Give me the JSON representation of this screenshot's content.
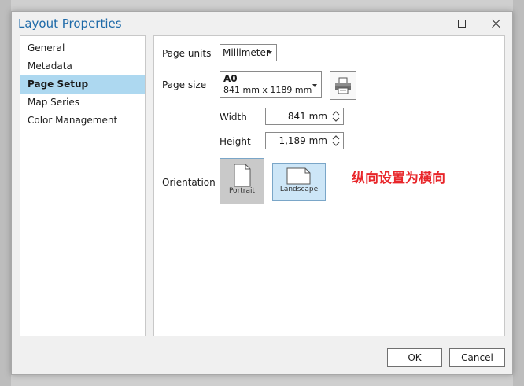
{
  "window": {
    "title": "Layout Properties"
  },
  "sidebar": {
    "items": [
      {
        "label": "General"
      },
      {
        "label": "Metadata"
      },
      {
        "label": "Page Setup"
      },
      {
        "label": "Map Series"
      },
      {
        "label": "Color Management"
      }
    ],
    "active_index": 2
  },
  "page_setup": {
    "units_label": "Page units",
    "units_value": "Millimeter",
    "size_label": "Page size",
    "size_name": "A0",
    "size_dims": "841 mm x 1189 mm",
    "width_label": "Width",
    "width_value": "841 mm",
    "height_label": "Height",
    "height_value": "1,189 mm",
    "orientation_label": "Orientation",
    "portrait_label": "Portrait",
    "landscape_label": "Landscape",
    "annotation": "纵向设置为横向"
  },
  "footer": {
    "ok_label": "OK",
    "cancel_label": "Cancel"
  },
  "colors": {
    "title": "#1e6aa8",
    "active_nav": "#add8f0",
    "annotation": "#e8262a"
  }
}
